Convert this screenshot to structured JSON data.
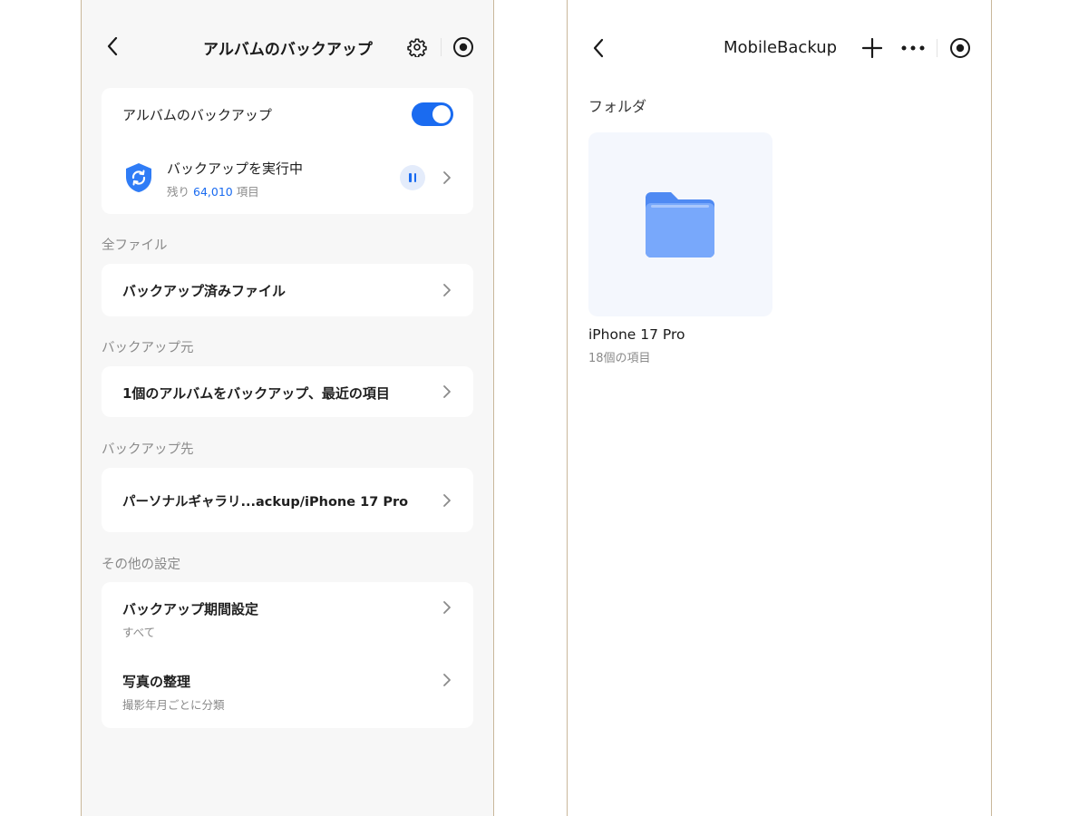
{
  "album_backup_screen": {
    "title": "アルバムのバックアップ",
    "back_icon": "chevron-left-icon",
    "settings_icon": "gear-icon",
    "record_icon": "record-icon",
    "main_card": {
      "toggle_label": "アルバムのバックアップ",
      "toggle_on": true,
      "status_title": "バックアップを実行中",
      "status_prefix": "残り",
      "remaining_count": "64,010",
      "status_suffix": "項目",
      "status_icon": "shield-sync-icon",
      "pause_icon": "pause-icon"
    },
    "all_files": {
      "section": "全ファイル",
      "item": "バックアップ済みファイル"
    },
    "backup_source": {
      "section": "バックアップ元",
      "item": "1個のアルバムをバックアップ、最近の項目"
    },
    "backup_destination": {
      "section": "バックアップ先",
      "item": "パーソナルギャラリ...ackup/iPhone 17 Pro"
    },
    "other_settings": {
      "section": "その他の設定",
      "items": [
        {
          "label": "バックアップ期間設定",
          "sub": "すべて"
        },
        {
          "label": "写真の整理",
          "sub": "撮影年月ごとに分類"
        }
      ]
    },
    "colors": {
      "accent": "#1a6bf0",
      "background": "#f7f7f7",
      "card": "#ffffff"
    }
  },
  "mobile_backup_screen": {
    "title": "MobileBackup",
    "back_icon": "chevron-left-icon",
    "add_icon": "plus-icon",
    "more_icon": "more-dots-icon",
    "record_icon": "record-icon",
    "section": "フォルダ",
    "folders": [
      {
        "name": "iPhone 17 Pro",
        "count": "18個の項目",
        "icon": "folder-icon"
      }
    ],
    "colors": {
      "folder": "#5b92f5",
      "tile": "#f4f7fd"
    }
  }
}
